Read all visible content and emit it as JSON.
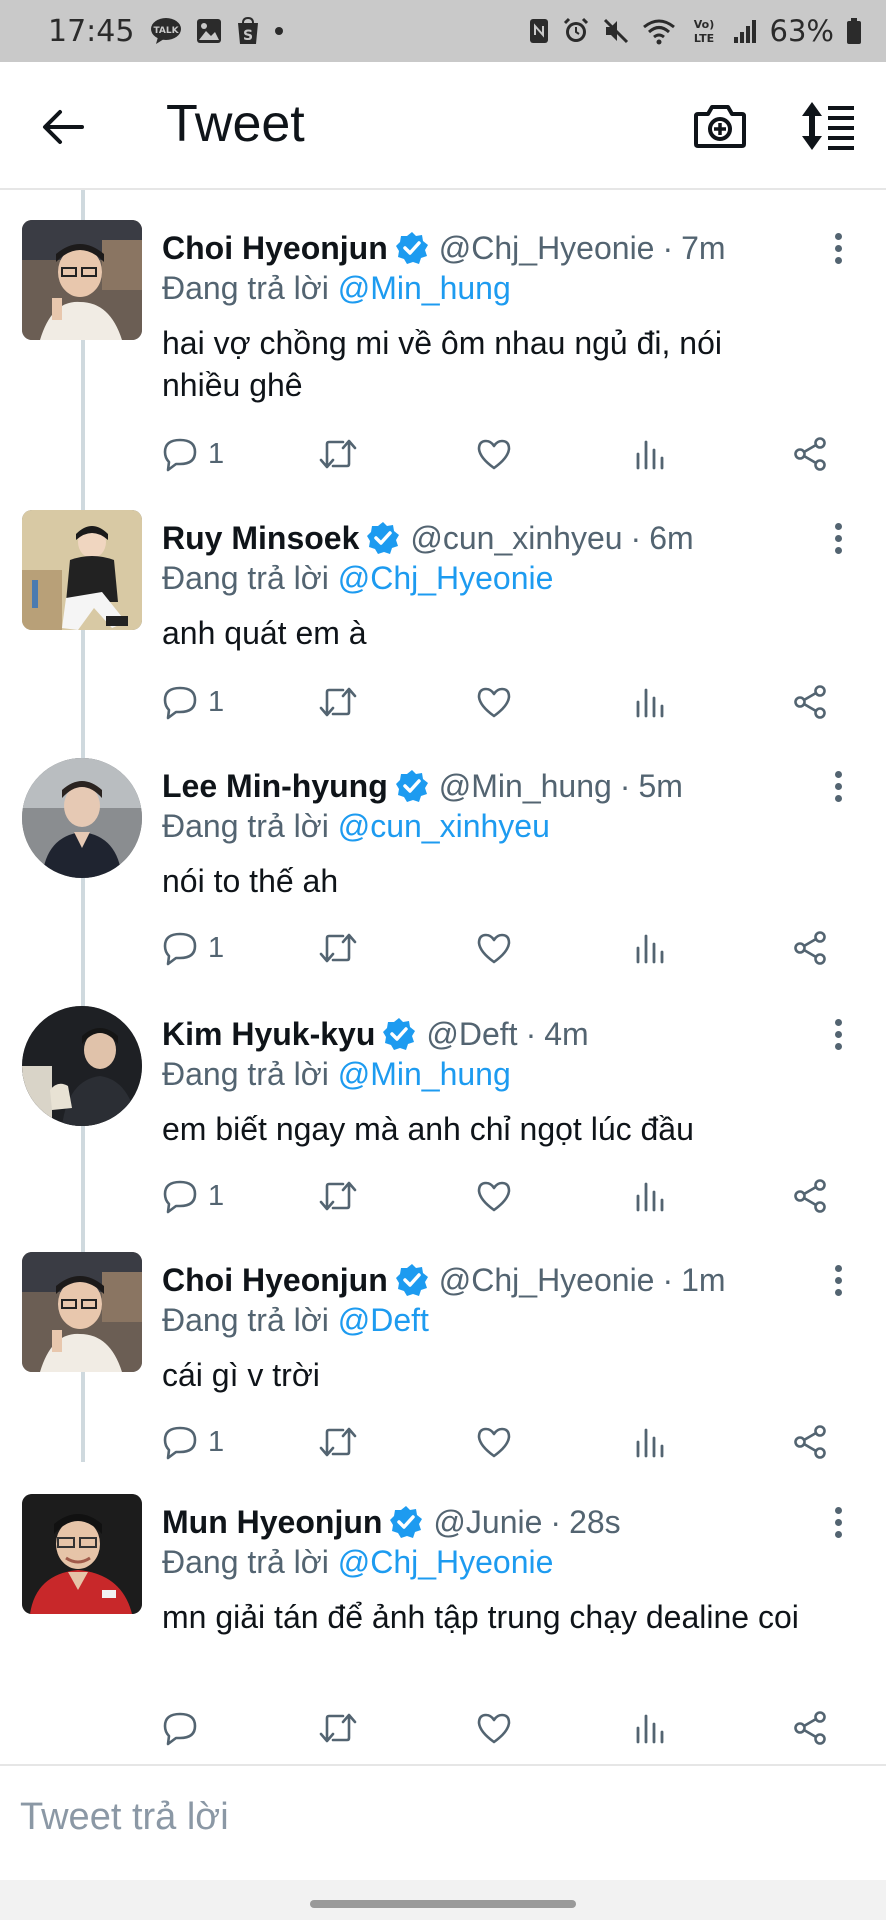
{
  "status_bar": {
    "time": "17:45",
    "left_icons": [
      "talk-icon",
      "gallery-icon",
      "s-icon",
      "dot-icon"
    ],
    "right_icons": [
      "nfc-icon",
      "alarm-icon",
      "mute-icon",
      "wifi-icon",
      "volte-icon",
      "signal-icon"
    ],
    "volte_label": "VoLTE",
    "battery_percent": "63%"
  },
  "header": {
    "title": "Tweet"
  },
  "reply_prefix": "Đang trả lời",
  "tweets": [
    {
      "name": "Choi Hyeonjun",
      "handle": "@Chj_Hyeonie",
      "dot": "·",
      "time": "7m",
      "reply_to": "@Min_hung",
      "text": "hai vợ chồng mi về ôm nhau ngủ đi, nói nhiều ghê",
      "reply_count": "1"
    },
    {
      "name": "Ruy Minsoek",
      "handle": "@cun_xinhyeu",
      "dot": "·",
      "time": "6m",
      "reply_to": "@Chj_Hyeonie",
      "text": "anh quát em à",
      "reply_count": "1"
    },
    {
      "name": "Lee Min-hyung",
      "handle": "@Min_hung",
      "dot": "·",
      "time": "5m",
      "reply_to": "@cun_xinhyeu",
      "text": "nói to thế ah",
      "reply_count": "1"
    },
    {
      "name": "Kim Hyuk-kyu",
      "handle": "@Deft",
      "dot": "·",
      "time": "4m",
      "reply_to": "@Min_hung",
      "text": "em biết ngay mà anh chỉ ngọt lúc đầu",
      "reply_count": "1"
    },
    {
      "name": "Choi Hyeonjun",
      "handle": "@Chj_Hyeonie",
      "dot": "·",
      "time": "1m",
      "reply_to": "@Deft",
      "text": "cái gì v trời",
      "reply_count": "1"
    },
    {
      "name": "Mun Hyeonjun",
      "handle": "@Junie",
      "dot": "·",
      "time": "28s",
      "reply_to": "@Chj_Hyeonie",
      "text": "mn giải tán để ảnh tập trung chạy dealine coi",
      "reply_count": ""
    }
  ],
  "reply_box": {
    "placeholder": "Tweet trả lời"
  },
  "colors": {
    "accent": "#1d9bf0",
    "secondary_text": "#536471",
    "status_bar_bg": "#c9c9c9"
  }
}
